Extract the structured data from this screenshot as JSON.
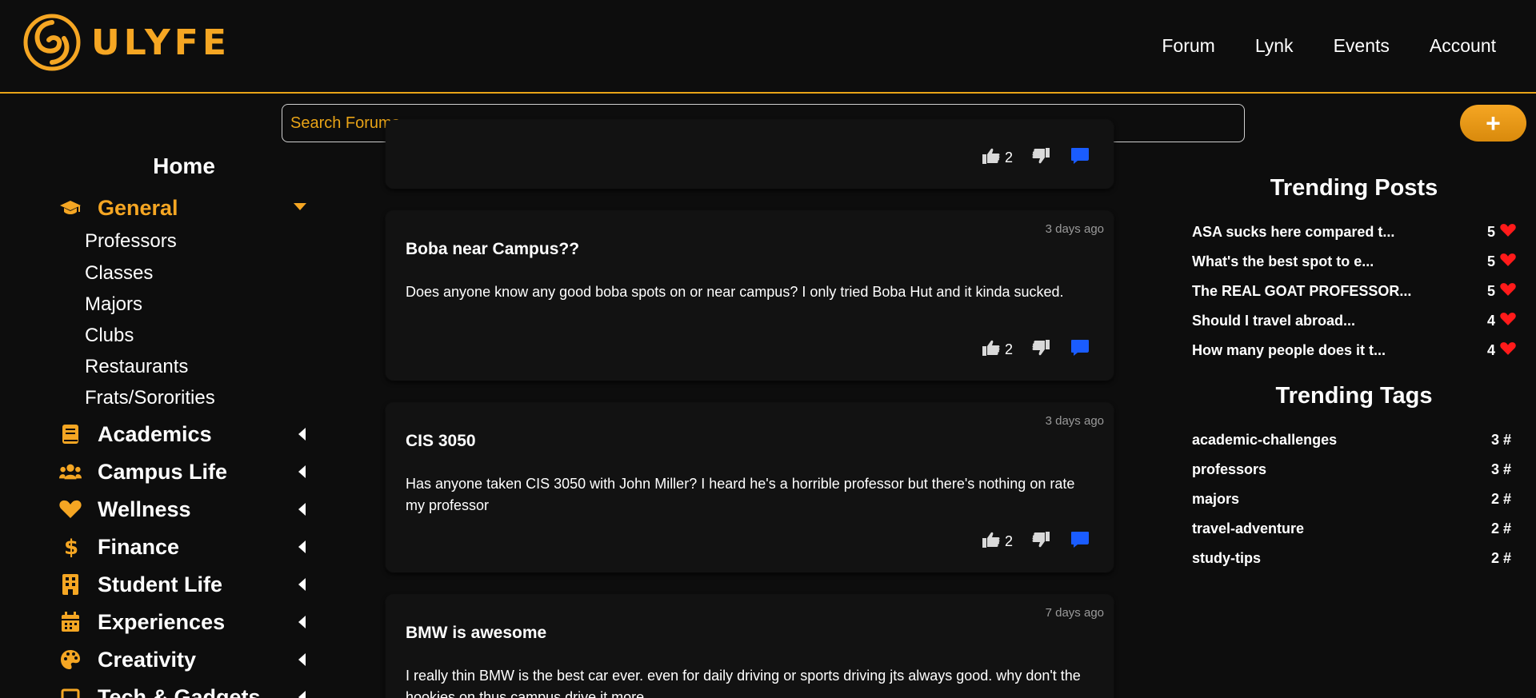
{
  "brand": {
    "name": "ULYFE",
    "accent": "#f5a623",
    "background": "#0d0d0d"
  },
  "nav": [
    "Forum",
    "Lynk",
    "Events",
    "Account"
  ],
  "search": {
    "placeholder": "Search Forums"
  },
  "new_post_label": "+",
  "sidebar": {
    "home": "Home",
    "categories": [
      {
        "label": "General",
        "icon": "graduation-cap-icon",
        "expanded": true,
        "subitems": [
          "Professors",
          "Classes",
          "Majors",
          "Clubs",
          "Restaurants",
          "Frats/Sororities"
        ]
      },
      {
        "label": "Academics",
        "icon": "book-icon"
      },
      {
        "label": "Campus Life",
        "icon": "users-icon"
      },
      {
        "label": "Wellness",
        "icon": "heart-icon"
      },
      {
        "label": "Finance",
        "icon": "dollar-icon"
      },
      {
        "label": "Student Life",
        "icon": "building-icon"
      },
      {
        "label": "Experiences",
        "icon": "calendar-icon"
      },
      {
        "label": "Creativity",
        "icon": "palette-icon"
      },
      {
        "label": "Tech & Gadgets",
        "icon": "laptop-icon"
      }
    ]
  },
  "posts": [
    {
      "time": "",
      "title": "",
      "body": "",
      "likes": "2"
    },
    {
      "time": "3 days ago",
      "title": "Boba near Campus??",
      "body": "Does anyone know any good boba spots on or near campus? I only tried Boba Hut and it kinda sucked.",
      "likes": "2"
    },
    {
      "time": "3 days ago",
      "title": "CIS 3050",
      "body": "Has anyone taken CIS 3050 with John Miller? I heard he's a horrible professor but there's nothing on rate my professor",
      "likes": "2"
    },
    {
      "time": "7 days ago",
      "title": "BMW is awesome",
      "body": "I really thin BMW is the best car ever. even for daily driving or sports driving jts always good. why don't the hookies on thus campus drive it more",
      "likes": ""
    }
  ],
  "trending_posts": {
    "heading": "Trending Posts",
    "items": [
      {
        "title": "ASA sucks here compared t...",
        "count": "5"
      },
      {
        "title": "What's the best spot to e...",
        "count": "5"
      },
      {
        "title": "The REAL GOAT PROFESSOR...",
        "count": "5"
      },
      {
        "title": "Should I travel abroad...",
        "count": "4"
      },
      {
        "title": "How many people does it t...",
        "count": "4"
      }
    ]
  },
  "trending_tags": {
    "heading": "Trending Tags",
    "items": [
      {
        "tag": "academic-challenges",
        "count": "3 #"
      },
      {
        "tag": "professors",
        "count": "3 #"
      },
      {
        "tag": "majors",
        "count": "2 #"
      },
      {
        "tag": "travel-adventure",
        "count": "2 #"
      },
      {
        "tag": "study-tips",
        "count": "2 #"
      }
    ]
  }
}
